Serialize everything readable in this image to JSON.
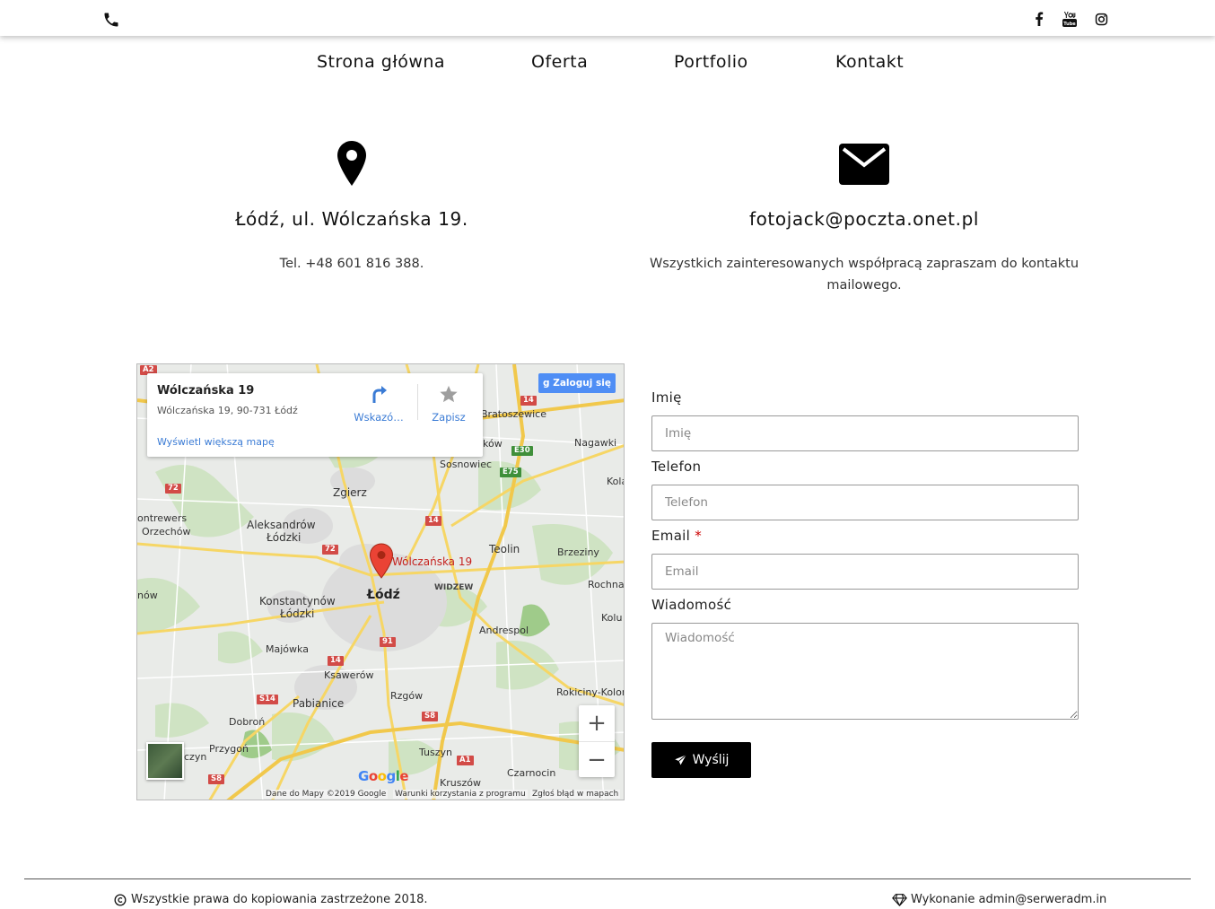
{
  "nav": {
    "items": [
      "Strona główna",
      "Oferta",
      "Portfolio",
      "Kontakt"
    ]
  },
  "contact": {
    "address": "Łódź, ul. Wólczańska 19.",
    "phone": "Tel. +48 601 816 388.",
    "email": "fotojack@poczta.onet.pl",
    "email_note": "Wszystkich zainteresowanych współpracą zapraszam do kontaktu mailowego."
  },
  "map": {
    "card_title": "Wólczańska 19",
    "card_address": "Wólczańska 19, 90-731 Łódź",
    "directions_label": "Wskazó…",
    "save_label": "Zapisz",
    "larger_map_link": "Wyświetl większą mapę",
    "signin_label": "Zaloguj się",
    "zoom_in": "+",
    "zoom_out": "−",
    "marker_label": "Wólczańska 19",
    "attribution": {
      "data": "Dane do Mapy ©2019 Google",
      "terms": "Warunki korzystania z programu",
      "report": "Zgłoś błąd w mapach"
    },
    "google_logo": [
      "G",
      "o",
      "o",
      "g",
      "l",
      "e"
    ],
    "places": {
      "zgierz": "Zgierz",
      "aleksandrow": "Aleksandrów",
      "aleksandrow2": "Łódzki",
      "konstantynow": "Konstantynów",
      "konstantynow2": "Łódzki",
      "lodz": "Łódź",
      "widzew": "WIDZEW",
      "teolin": "Teolin",
      "brzeziny": "Brzeziny",
      "rochna": "Rochna",
      "kolu": "Kolu",
      "andrespol": "Andrespol",
      "majowka": "Majówka",
      "ksawerow": "Ksawerów",
      "pabianice": "Pabianice",
      "rzgow": "Rzgów",
      "dobron": "Dobroń",
      "przygon": "Przygoń",
      "tuszyn": "Tuszyn",
      "czarnocin": "Czarnocin",
      "kruszow": "Kruszów",
      "rokiciny": "Rokiciny-Kolon",
      "sosnowiec": "Sosnowiec",
      "nagawki": "Nagawki",
      "bratoszewice": "Bratoszewice",
      "kow": "ków",
      "kola": "Kola",
      "ontrewers": "ontrewers",
      "orzechow": "Orzechów",
      "now": "nów",
      "czyn": "czyn"
    },
    "shields": {
      "a2": "A2",
      "r14a": "14",
      "e30": "E30",
      "e75": "E75",
      "r72a": "72",
      "r14b": "14",
      "r72b": "72",
      "r91": "91",
      "r14c": "14",
      "s14": "S14",
      "s8a": "S8",
      "a1": "A1",
      "s8b": "S8"
    }
  },
  "form": {
    "name_label": "Imię",
    "name_placeholder": "Imię",
    "phone_label": "Telefon",
    "phone_placeholder": "Telefon",
    "email_label": "Email",
    "email_required": "*",
    "email_placeholder": "Email",
    "message_label": "Wiadomość",
    "message_placeholder": "Wiadomość",
    "submit_label": "Wyślij"
  },
  "footer": {
    "copyright": "Wszystkie prawa do kopiowania zastrzeżone 2018.",
    "credit": "Wykonanie admin@serweradm.in"
  }
}
